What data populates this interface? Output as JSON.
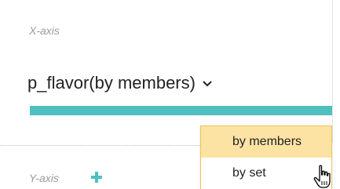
{
  "panel": {
    "x_axis_label": "X-axis",
    "y_axis_label": "Y-axis",
    "field_name": "p_flavor(by members)",
    "accent_color": "#4ec0bf",
    "highlight_color": "#fce3a4",
    "dropdown_border_color": "#f0c35a"
  },
  "dropdown": {
    "options": [
      {
        "label": "by members",
        "highlighted": true
      },
      {
        "label": "by set",
        "highlighted": false
      }
    ]
  },
  "icons": {
    "chevron": "chevron-down-icon",
    "add": "plus-icon",
    "cursor": "hand-pointer-cursor-icon"
  }
}
